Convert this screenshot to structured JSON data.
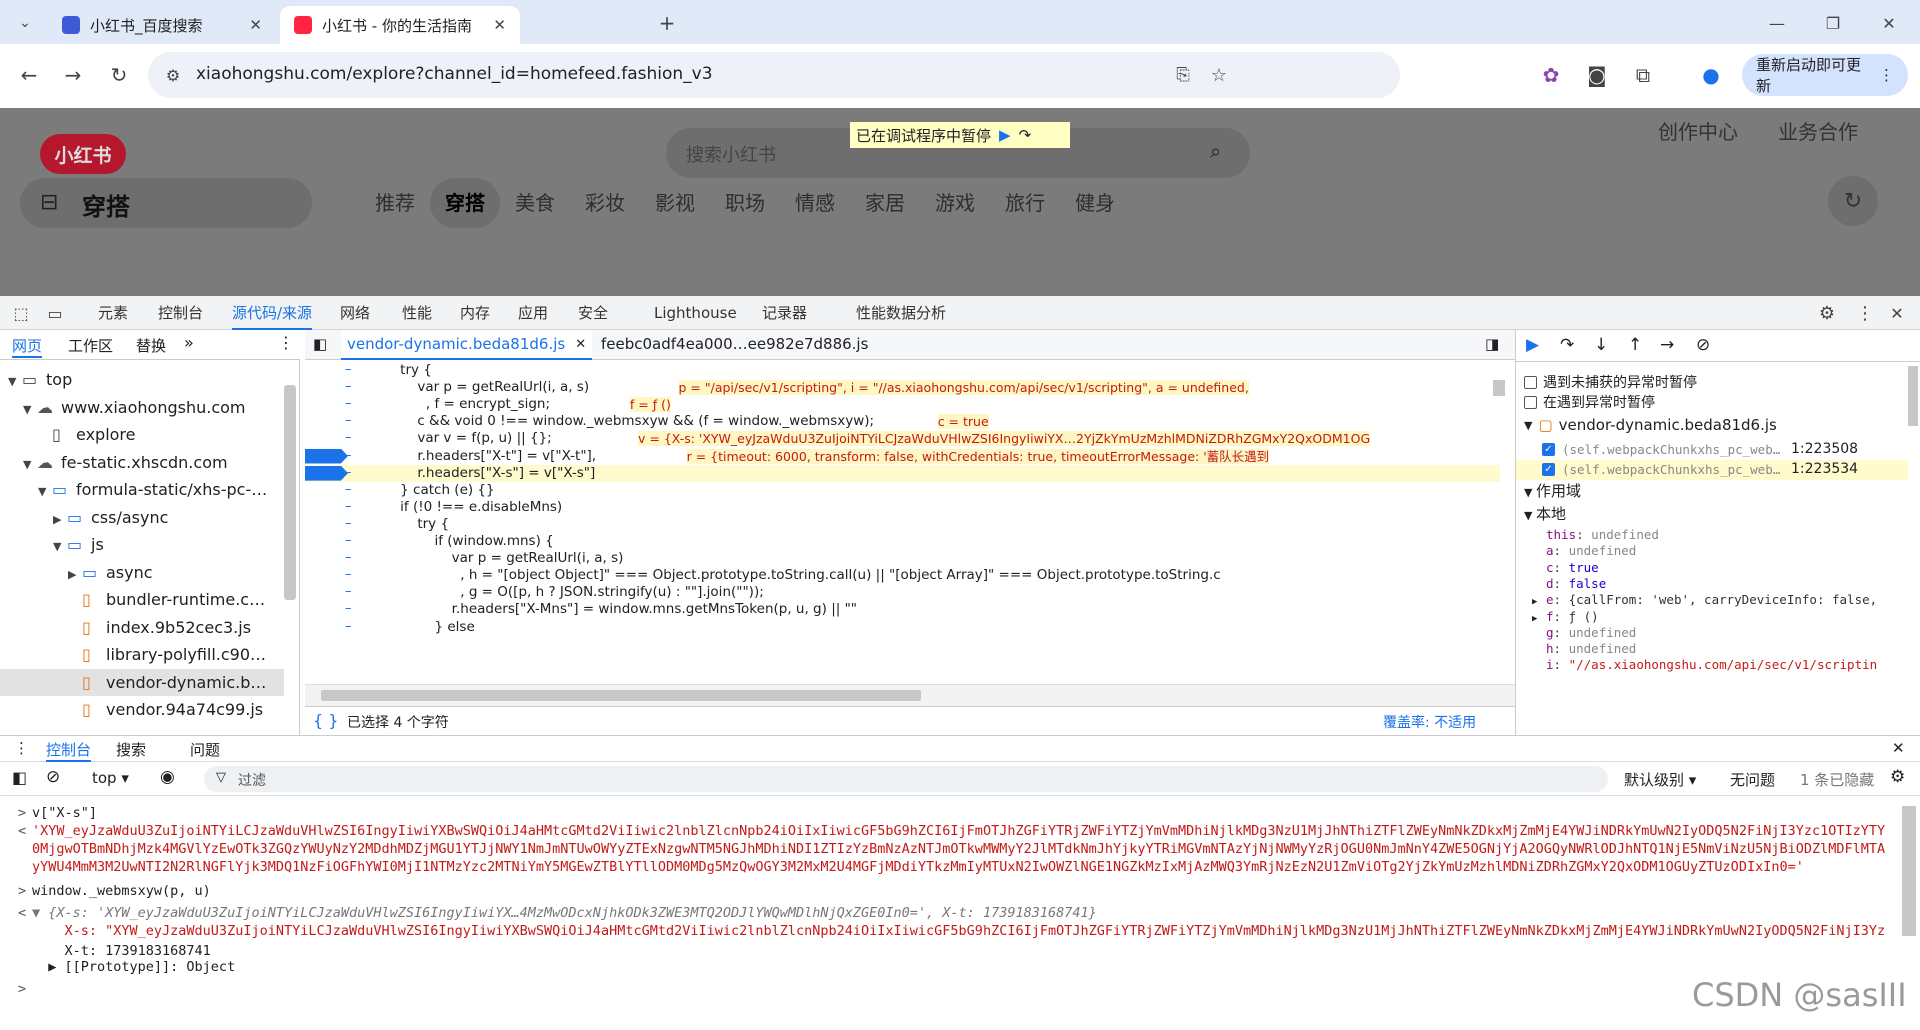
{
  "browser": {
    "tabs": [
      {
        "title": "小红书_百度搜索",
        "close": "✕"
      },
      {
        "title": "小红书 - 你的生活指南",
        "close": "✕"
      }
    ],
    "new_tab": "+",
    "url": "xiaohongshu.com/explore?channel_id=homefeed.fashion_v3",
    "update_label": "重新启动即可更新"
  },
  "site": {
    "logo": "小红书",
    "search_placeholder": "搜索小红书",
    "paused_banner": "已在调试程序中暂停",
    "header_links": [
      "创作中心",
      "业务合作"
    ],
    "channel_big": "穿搭",
    "channels": [
      "推荐",
      "穿搭",
      "美食",
      "彩妆",
      "影视",
      "职场",
      "情感",
      "家居",
      "游戏",
      "旅行",
      "健身"
    ]
  },
  "devtools": {
    "tabs": [
      "元素",
      "控制台",
      "源代码/来源",
      "网络",
      "性能",
      "内存",
      "应用",
      "安全",
      "Lighthouse",
      "记录器",
      "性能数据分析"
    ],
    "left_tabs": [
      "网页",
      "工作区",
      "替换"
    ],
    "tree": [
      {
        "label": "top",
        "indent": 0,
        "arrow": "▼",
        "icon": "frame"
      },
      {
        "label": "www.xiaohongshu.com",
        "indent": 1,
        "arrow": "▼",
        "icon": "cloud"
      },
      {
        "label": "explore",
        "indent": 2,
        "arrow": "",
        "icon": "file"
      },
      {
        "label": "fe-static.xhscdn.com",
        "indent": 1,
        "arrow": "▼",
        "icon": "cloud"
      },
      {
        "label": "formula-static/xhs-pc-…",
        "indent": 2,
        "arrow": "▼",
        "icon": "folder"
      },
      {
        "label": "css/async",
        "indent": 3,
        "arrow": "▶",
        "icon": "folder"
      },
      {
        "label": "js",
        "indent": 3,
        "arrow": "▼",
        "icon": "folder"
      },
      {
        "label": "async",
        "indent": 4,
        "arrow": "▶",
        "icon": "folder"
      },
      {
        "label": "bundler-runtime.c…",
        "indent": 4,
        "arrow": "",
        "icon": "jsfile"
      },
      {
        "label": "index.9b52cec3.js",
        "indent": 4,
        "arrow": "",
        "icon": "jsfile"
      },
      {
        "label": "library-polyfill.c90…",
        "indent": 4,
        "arrow": "",
        "icon": "jsfile"
      },
      {
        "label": "vendor-dynamic.b…",
        "indent": 4,
        "arrow": "",
        "icon": "jsfile"
      },
      {
        "label": "vendor.94a74c99.js",
        "indent": 4,
        "arrow": "",
        "icon": "jsfile"
      }
    ],
    "file_tabs": [
      "vendor-dynamic.beda81d6.js",
      "feebc0adf4ea000…ee982e7d886.js"
    ],
    "file_tab_close": "✕",
    "code_lines": [
      "    try {",
      "        var p = getRealUrl(i, a, s)",
      "          , f = encrypt_sign;",
      "        c && void 0 !== window._webmsxyw && (f = window._webmsxyw);",
      "        var v = f(p, u) || {};",
      "        r.headers[\"X-t\"] = v[\"X-t\"],",
      "        r.headers[\"X-s\"] = v[\"X-s\"]",
      "    } catch (e) {}",
      "    if (!0 !== e.disableMns)",
      "        try {",
      "            if (window.mns) {",
      "                var p = getRealUrl(i, a, s)",
      "                  , h = \"[object Object]\" === Object.prototype.toString.call(u) || \"[object Array]\" === Object.prototype.toString.c",
      "                  , g = O([p, h ? JSON.stringify(u) : \"\"].join(\"\"));",
      "                r.headers[\"X-Mns\"] = window.mns.getMnsToken(p, u, g) || \"\"",
      "            } else"
    ],
    "inline_values": [
      "",
      "p = \"/api/sec/v1/scripting\", i = \"//as.xiaohongshu.com/api/sec/v1/scripting\", a = undefined,",
      "f = ƒ ()",
      "c = true",
      "v = {X-s: 'XYW_eyJzaWduU3ZuIjoiNTYiLCJzaWduVHlwZSI6IngyIiwiYX…2YjZkYmUzMzhlMDNiZDRhZGMxY2QxODM1OG",
      "r = {timeout: 6000, transform: false, withCredentials: true, timeoutErrorMessage: '蓄队长遇到",
      "",
      "",
      "",
      "",
      "",
      "",
      "",
      "",
      "",
      ""
    ],
    "status_selected": "已选择 4 个字符",
    "coverage": "覆盖率: 不适用",
    "breakpoint_options": [
      "遇到未捕获的异常时暂停",
      "在遇到异常时暂停"
    ],
    "breakpoint_file": "vendor-dynamic.beda81d6.js",
    "breakpoints": [
      {
        "code": "(self.webpackChunkxhs_pc_web…",
        "loc": "1:223508"
      },
      {
        "code": "(self.webpackChunkxhs_pc_web…",
        "loc": "1:223534"
      }
    ],
    "scope_label": "作用域",
    "local_label": "本地",
    "scope_vars": [
      {
        "name": "this",
        "value": "undefined"
      },
      {
        "name": "a",
        "value": "undefined"
      },
      {
        "name": "c",
        "value": "true"
      },
      {
        "name": "d",
        "value": "false"
      },
      {
        "name": "e",
        "value": "{callFrom: 'web', carryDeviceInfo: false,"
      },
      {
        "name": "f",
        "value": "ƒ ()"
      },
      {
        "name": "g",
        "value": "undefined"
      },
      {
        "name": "h",
        "value": "undefined"
      },
      {
        "name": "i",
        "value": "\"//as.xiaohongshu.com/api/sec/v1/scriptin"
      }
    ]
  },
  "console": {
    "tabs": [
      "控制台",
      "搜索",
      "问题"
    ],
    "context": "top",
    "filter_placeholder": "过滤",
    "level": "默认级别",
    "issues": "无问题",
    "hidden": "1 条已隐藏",
    "lines": [
      {
        "prefix": ">",
        "text": "v[\"X-s\"]"
      },
      {
        "prefix": "<",
        "text": "'XYW_eyJzaWduU3ZuIjoiNTYiLCJzaWduVHlwZSI6IngyIiwiYXBwSWQiOiJ4aHMtcGMtd2ViIiwic2lnblZlcnNpb24iOiIxIiwicGF5bG9hZCI6IjFmOTJhZGFiYTRjZWFiYTZjYmVmMDhiNjlkMDg3NzU1MjJhNThiZTFlZWEyNmNkZDkxMjZmMjE4YWJiNDRkYmUwN2IyODQ5N2FiNjI3Yzc1OTIzYTY"
      },
      {
        "prefix": "",
        "text": "0MjgwOTBmNDhjMzk4MGVlYzEwOTk3ZGQzYWUyNzY2MDdhMDZjMGU1YTJjNWY1NmJmNTUwOWYyZTExNzgwNTM5NGJhMDhiNDI1ZTIzYzBmNzAzNTJmOTkwMWMyY2JlMTdkNmJhYjkyYTRiMGVmNTAzYjNjNWMyYzRjOGU0NmJmNnY4ZWE5OGNjYjA2OGQyNWRlODJhNTQ1NjE5NmViNzU5NjBiODZlMDFlMTA"
      },
      {
        "prefix": "",
        "text": "yYWU4MmM3M2UwNTI2N2RlNGFlYjk3MDQ1NzFiOGFhYWI0MjI1NTMzYzc2MTNiYmY5MGEwZTBlYTllODM0MDg5MzQwOGY3M2MxM2U4MGFjMDdiYTkzMmIyMTUxN2IwOWZlNGE1NGZkMzIxMjAzMWQ3YmRjNzEzN2U1ZmViOTg2YjZkYmUzMzhlMDNiZDRhZGMxY2QxODM1OGUyZTUzODIxIn0='"
      },
      {
        "prefix": ">",
        "text": "window._webmsxyw(p, u)"
      },
      {
        "prefix": "<",
        "text": "▼ {X-s: 'XYW_eyJzaWduU3ZuIjoiNTYiLCJzaWduVHlwZSI6IngyIiwiYX…4MzMwODcxNjhkODk3ZWE3MTQ2ODJlYWQwMDlhNjQxZGE0In0=', X-t: 1739183168741}"
      },
      {
        "prefix": "",
        "text": "    X-s: \"XYW_eyJzaWduU3ZuIjoiNTYiLCJzaWduVHlwZSI6IngyIiwiYXBwSWQiOiJ4aHMtcGMtd2ViIiwic2lnblZlcnNpb24iOiIxIiwicGF5bG9hZCI6IjFmOTJhZGFiYTRjZWFiYTZjYmVmMDhiNjlkMDg3NzU1MjJhNThiZTFlZWEyNmNkZDkxMjZmMjE4YWJiNDRkYmUwN2IyODQ5N2FiNjI3Yz"
      },
      {
        "prefix": "",
        "text": "    X-t: 1739183168741"
      },
      {
        "prefix": "",
        "text": "  ▶ [[Prototype]]: Object"
      },
      {
        "prefix": ">",
        "text": ""
      }
    ],
    "watermark": "CSDN @sasIII"
  },
  "colors": {
    "accent": "#1a73e8",
    "brand": "#ff2442",
    "string": "#c41a16"
  }
}
